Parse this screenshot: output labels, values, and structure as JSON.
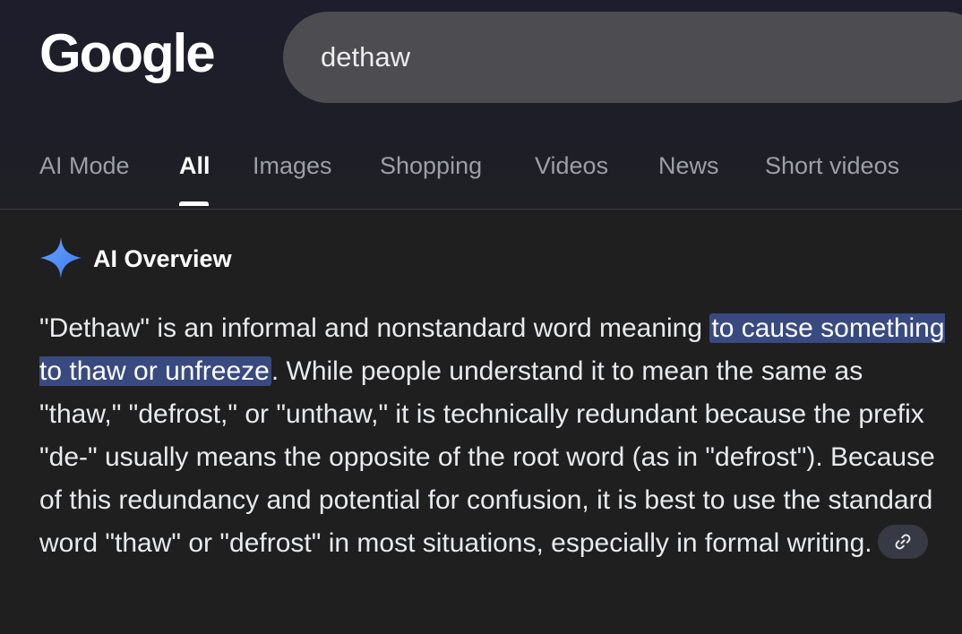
{
  "header": {
    "logo": "Google",
    "search": {
      "value": "dethaw"
    }
  },
  "tabs": [
    {
      "label": "AI Mode",
      "active": false
    },
    {
      "label": "All",
      "active": true
    },
    {
      "label": "Images",
      "active": false
    },
    {
      "label": "Shopping",
      "active": false
    },
    {
      "label": "Videos",
      "active": false
    },
    {
      "label": "News",
      "active": false
    },
    {
      "label": "Short videos",
      "active": false
    }
  ],
  "ai_overview": {
    "icon": "gemini-sparkle-icon",
    "title": "AI Overview",
    "text_before": "\"Dethaw\" is an informal and nonstandard word meaning ",
    "highlight": "to cause something to thaw or unfreeze",
    "text_after": ". While people understand it to mean the same as \"thaw,\" \"defrost,\" or \"unthaw,\" it is technically redundant because the prefix \"de-\" usually means the opposite of the root word (as in \"defrost\"). Because of this redundancy and potential for confusion, it is best to use the standard word \"thaw\" or \"defrost\" in most situations, especially in formal writing.",
    "link_icon": "link-icon"
  },
  "colors": {
    "background": "#1f1f1f",
    "search_box": "#4d4d51",
    "highlight": "#394a80",
    "sparkle_blue": "#4c8df6",
    "inactive_tab": "#9aa0a6"
  }
}
